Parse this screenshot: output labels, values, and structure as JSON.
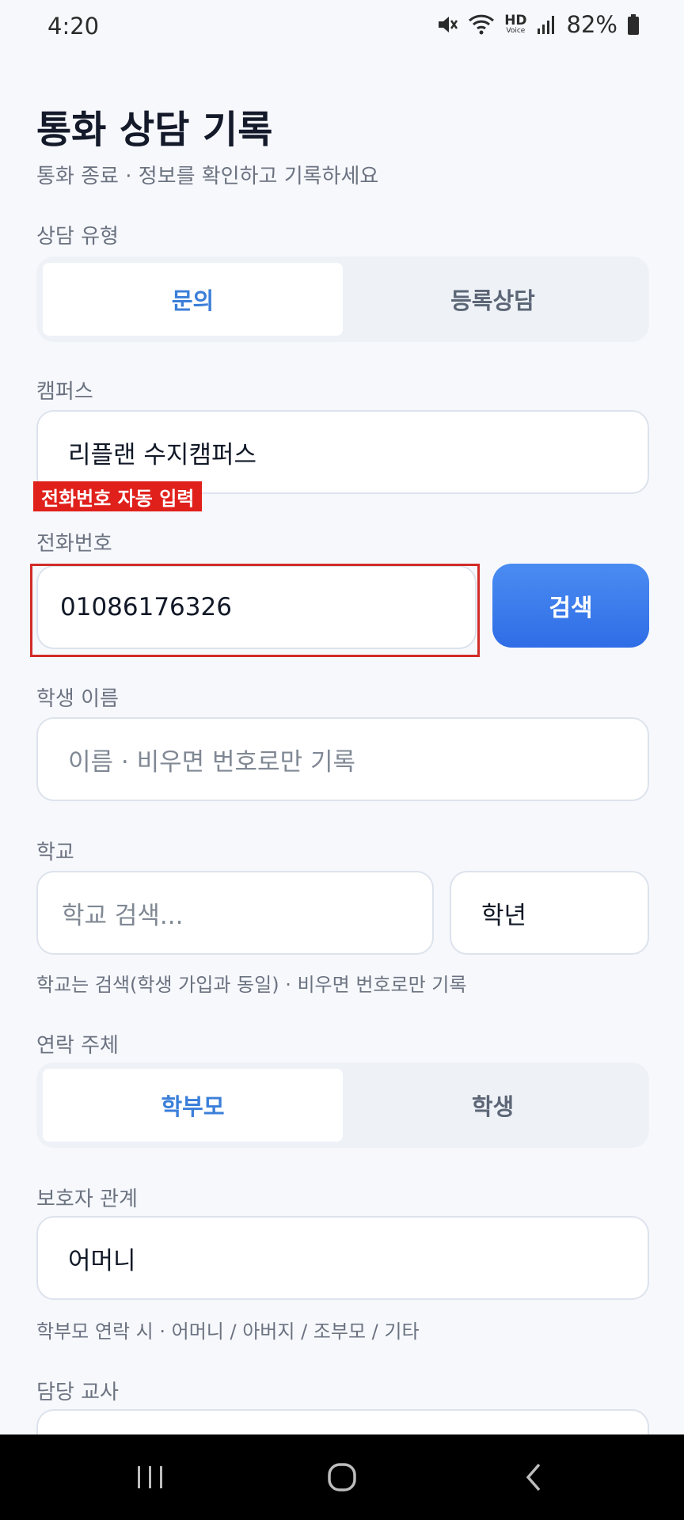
{
  "status": {
    "time": "4:20",
    "hd": "HD",
    "voice": "Voice",
    "battery": "82%"
  },
  "header": {
    "title": "통화 상담 기록",
    "subtitle": "통화 종료 · 정보를 확인하고 기록하세요"
  },
  "consult_type": {
    "label": "상담 유형",
    "options": [
      "문의",
      "등록상담"
    ],
    "selected": "문의"
  },
  "campus": {
    "label": "캠퍼스",
    "value": "리플랜 수지캠퍼스"
  },
  "phone": {
    "badge": "전화번호 자동 입력",
    "label": "전화번호",
    "value": "01086176326",
    "search_label": "검색"
  },
  "student_name": {
    "label": "학생 이름",
    "placeholder": "이름 · 비우면 번호로만 기록"
  },
  "school": {
    "label": "학교",
    "placeholder": "학교 검색...",
    "grade_label": "학년",
    "hint": "학교는 검색(학생 가입과 동일) · 비우면 번호로만 기록"
  },
  "contact_subject": {
    "label": "연락 주체",
    "options": [
      "학부모",
      "학생"
    ],
    "selected": "학부모"
  },
  "guardian": {
    "label": "보호자 관계",
    "value": "어머니",
    "hint": "학부모 연락 시 · 어머니 / 아버지 / 조부모 / 기타"
  },
  "teacher": {
    "label": "담당 교사"
  },
  "colors": {
    "accent": "#3B7FD9",
    "button": "#2F6DE6",
    "badge": "#E0201B",
    "background": "#F6F8FC"
  }
}
